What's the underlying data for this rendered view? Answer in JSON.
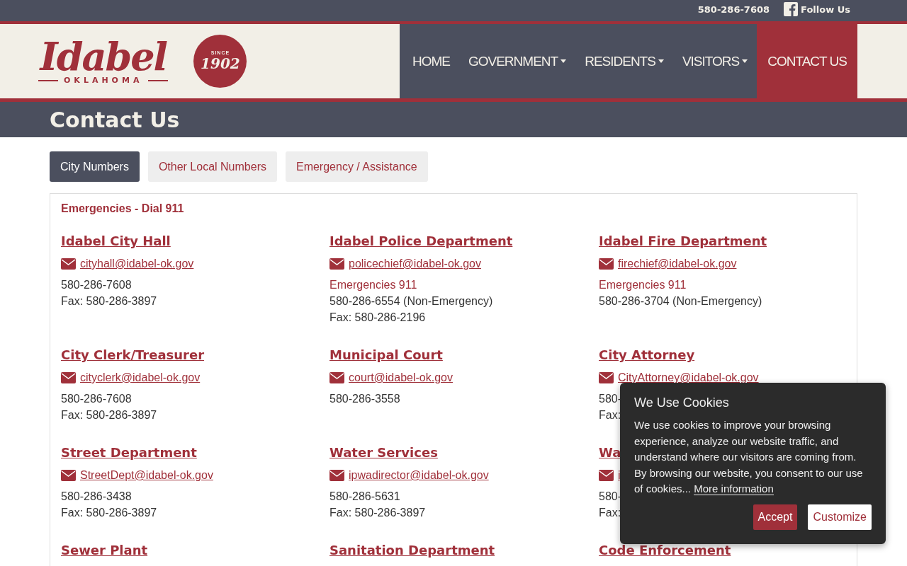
{
  "top_bar": {
    "phone": "580-286-7608",
    "social": "Follow Us"
  },
  "logo": {
    "name": "Idabel",
    "state": "OKLAHOMA",
    "badge_top": "SINCE",
    "badge_year": "1902"
  },
  "nav": [
    {
      "label": "HOME",
      "dropdown": false,
      "selected": false
    },
    {
      "label": "GOVERNMENT",
      "dropdown": true,
      "selected": false
    },
    {
      "label": "RESIDENTS",
      "dropdown": true,
      "selected": false
    },
    {
      "label": "VISITORS",
      "dropdown": true,
      "selected": false
    },
    {
      "label": "CONTACT US",
      "dropdown": false,
      "selected": true
    }
  ],
  "page_title": "Contact Us",
  "tabs": [
    {
      "label": "City Numbers",
      "selected": true
    },
    {
      "label": "Other Local Numbers",
      "selected": false
    },
    {
      "label": "Emergency / Assistance",
      "selected": false
    }
  ],
  "panel": {
    "notice": "Emergencies - Dial 911",
    "contacts": [
      {
        "name": "Idabel City Hall",
        "email": "cityhall@idabel-ok.gov",
        "lines": [
          {
            "text": "580-286-7608",
            "kind": "plain"
          },
          {
            "text": "Fax: 580-286-3897",
            "kind": "plain"
          }
        ]
      },
      {
        "name": "Idabel Police Department",
        "email": "policechief@idabel-ok.gov",
        "lines": [
          {
            "text": "Emergencies 911",
            "kind": "emergency"
          },
          {
            "text": "580-286-6554 (Non-Emergency)",
            "kind": "plain"
          },
          {
            "text": "Fax: 580-286-2196",
            "kind": "plain"
          }
        ]
      },
      {
        "name": "Idabel Fire Department",
        "email": "firechief@idabel-ok.gov",
        "lines": [
          {
            "text": "Emergencies 911",
            "kind": "emergency"
          },
          {
            "text": "580-286-3704 (Non-Emergency)",
            "kind": "plain"
          }
        ]
      },
      {
        "name": "City Clerk/Treasurer",
        "email": "cityclerk@idabel-ok.gov",
        "lines": [
          {
            "text": "580-286-7608",
            "kind": "plain"
          },
          {
            "text": "Fax: 580-286-3897",
            "kind": "plain"
          }
        ]
      },
      {
        "name": "Municipal Court",
        "email": "court@idabel-ok.gov",
        "lines": [
          {
            "text": "580-286-3558",
            "kind": "plain"
          }
        ]
      },
      {
        "name": "City Attorney",
        "email": "CityAttorney@idabel-ok.gov",
        "lines": [
          {
            "text": "580-",
            "kind": "plain"
          },
          {
            "text": "Fax:",
            "kind": "plain"
          }
        ]
      },
      {
        "name": "Street Department",
        "email": "StreetDept@idabel-ok.gov",
        "lines": [
          {
            "text": "580-286-3438",
            "kind": "plain"
          },
          {
            "text": "Fax: 580-286-3897",
            "kind": "plain"
          }
        ]
      },
      {
        "name": "Water Services",
        "email": "ipwadirector@idabel-ok.gov",
        "lines": [
          {
            "text": "580-286-5631",
            "kind": "plain"
          },
          {
            "text": "Fax: 580-286-3897",
            "kind": "plain"
          }
        ]
      },
      {
        "name": "Wa",
        "email": "i",
        "lines": [
          {
            "text": "580-",
            "kind": "plain"
          },
          {
            "text": "Fax:",
            "kind": "plain"
          }
        ]
      },
      {
        "name": "Sewer Plant"
      },
      {
        "name": "Sanitation Department"
      },
      {
        "name": "Code Enforcement"
      }
    ]
  },
  "cookie_banner": {
    "title": "We Use Cookies",
    "text": "We use cookies to improve your browsing experience, analyze our website traffic, and understand where our visitors are coming from. By browsing our website, you consent to our use of cookies...",
    "link": "More information",
    "buttons": [
      {
        "label": "Accept",
        "kind": "primary"
      },
      {
        "label": "Customize",
        "kind": "secondary"
      }
    ]
  }
}
